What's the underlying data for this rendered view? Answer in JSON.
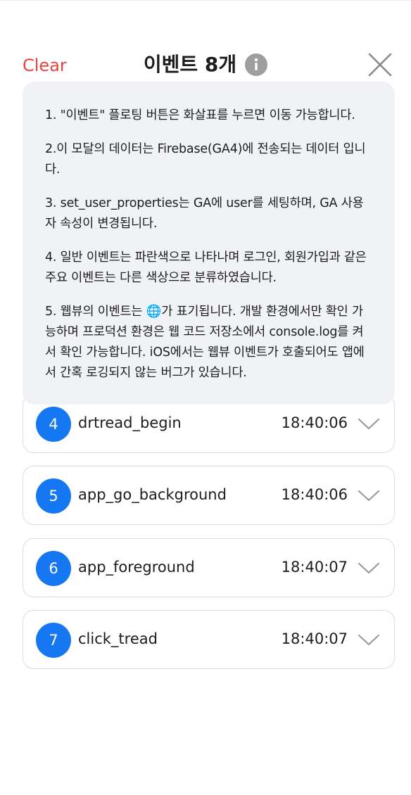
{
  "header": {
    "clear_label": "Clear",
    "title": "이벤트 8개"
  },
  "info_panel": {
    "lines": [
      "1. \"이벤트\" 플로팅 버튼은 화살표를 누르면 이동 가능합니다.",
      "2.이 모달의 데이터는 Firebase(GA4)에 전송되는 데이터 입니다.",
      "3. set_user_properties는 GA에 user를 세팅하며, GA 사용자 속성이 변경됩니다.",
      "4. 일반 이벤트는 파란색으로 나타나며 로그인, 회원가입과 같은 주요 이벤트는 다른 색상으로 분류하였습니다.",
      "5. 웹뷰의 이벤트는 🌐가 표기됩니다. 개발 환경에서만 확인 가능하며 프로덕션 환경은 웹 코드 저장소에서 console.log를 켜서 확인 가능합니다. iOS에서는 웹뷰 이벤트가 호출되어도 앱에서 간혹 로깅되지 않는 버그가 있습니다."
    ]
  },
  "events": [
    {
      "num": "4",
      "name": "drtread_begin",
      "time": "18:40:06"
    },
    {
      "num": "5",
      "name": "app_go_background",
      "time": "18:40:06"
    },
    {
      "num": "6",
      "name": "app_foreground",
      "time": "18:40:07"
    },
    {
      "num": "7",
      "name": "click_tread",
      "time": "18:40:07"
    }
  ],
  "colors": {
    "accent_red": "#e8453c",
    "event_blue": "#1677f2",
    "panel_bg": "#f0f2f5"
  }
}
